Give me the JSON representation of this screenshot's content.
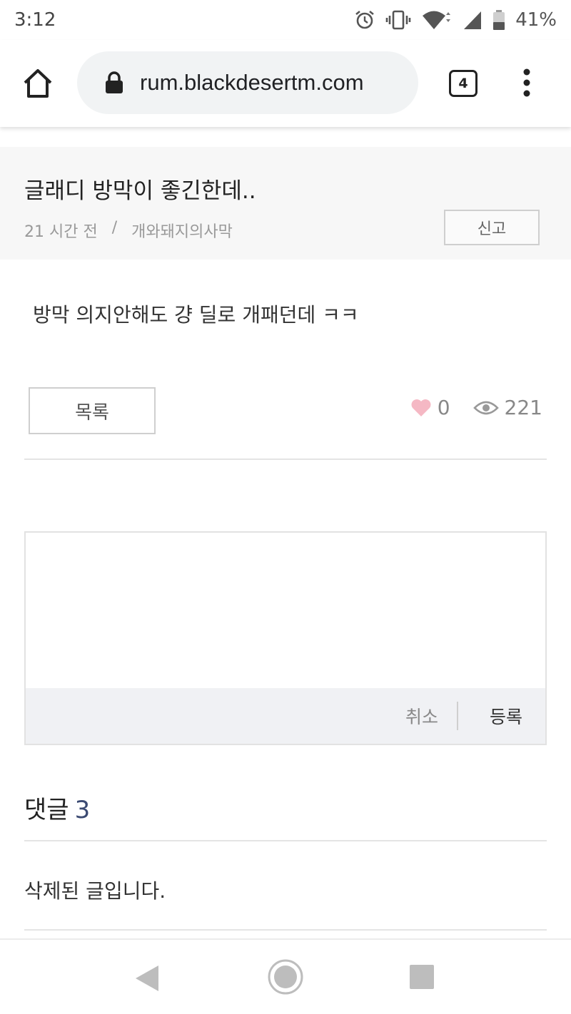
{
  "status_bar": {
    "time": "3:12",
    "battery_percent": "41%",
    "icons": [
      "alarm-icon",
      "vibrate-icon",
      "wifi-icon",
      "signal-icon",
      "battery-icon"
    ]
  },
  "browser": {
    "url": "rum.blackdesertm.com",
    "tab_count": "4",
    "icons": [
      "home-icon",
      "lock-icon",
      "tabs-icon",
      "more-vert-icon"
    ]
  },
  "post": {
    "title": "글래디 방막이 좋긴한데..",
    "time_ago": "21 시간 전",
    "separator": "/",
    "author": "개와돼지의사막",
    "report_label": "신고",
    "body": "방막 의지안해도 걍 딜로 개패던데 ㅋㅋ",
    "list_label": "목록",
    "likes": "0",
    "views": "221"
  },
  "comment_form": {
    "placeholder": "",
    "cancel_label": "취소",
    "submit_label": "등록"
  },
  "comments": {
    "title": "댓글",
    "count": "3",
    "items": [
      {
        "text": "삭제된 글입니다."
      }
    ]
  },
  "colors": {
    "accent_count": "#3b4a72",
    "heart": "#f5b8c4",
    "header_bg": "#f7f7f7",
    "url_pill_bg": "#f1f3f4"
  }
}
